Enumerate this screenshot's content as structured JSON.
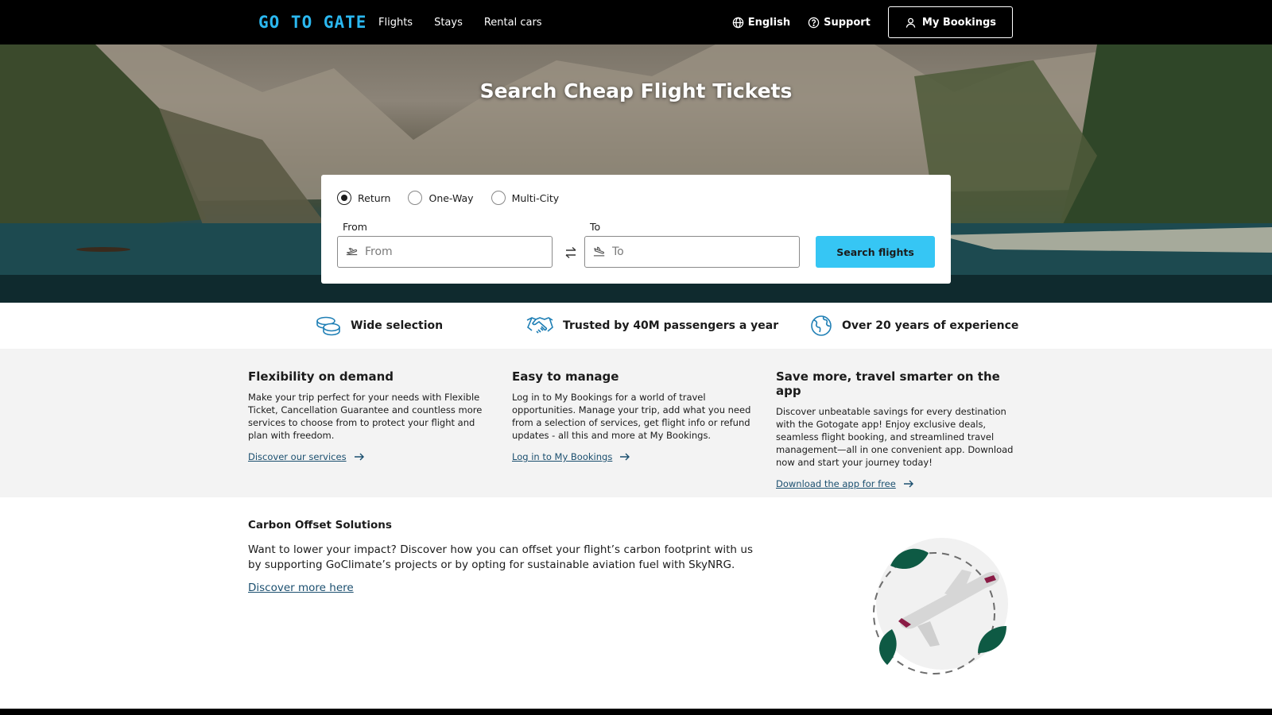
{
  "header": {
    "logo": "GO TO GATE",
    "nav": [
      "Flights",
      "Stays",
      "Rental cars"
    ],
    "language": "English",
    "support": "Support",
    "my_bookings": "My Bookings"
  },
  "hero": {
    "title": "Search Cheap Flight Tickets",
    "trip_types": [
      "Return",
      "One-Way",
      "Multi-City"
    ],
    "selected_trip_type": "Return",
    "from_label": "From",
    "from_placeholder": "From",
    "to_label": "To",
    "to_placeholder": "To",
    "search_button": "Search flights"
  },
  "usp": [
    "Wide selection",
    "Trusted by 40M passengers a year",
    "Over 20 years of experience"
  ],
  "features": [
    {
      "title": "Flexibility on demand",
      "text": "Make your trip perfect for your needs with Flexible Ticket, Cancellation Guarantee and countless more services to choose from to protect your flight and plan with freedom.",
      "link": "Discover our services"
    },
    {
      "title": "Easy to manage",
      "text": "Log in to My Bookings for a world of travel opportunities. Manage your trip, add what you need from a selection of services, get flight info or refund updates - all this and more at My Bookings.",
      "link": "Log in to My Bookings"
    },
    {
      "title": "Save more, travel smarter on the app",
      "text": "Discover unbeatable savings for every destination with the Gotogate app! Enjoy exclusive deals, seamless flight booking, and streamlined travel management—all in one convenient app. Download now and start your journey today!",
      "link": "Download the app for free"
    }
  ],
  "carbon": {
    "title": "Carbon Offset Solutions",
    "text": "Want to lower your impact? Discover how you can offset your flight’s carbon footprint with us by supporting GoClimate’s projects or by opting for sustainable aviation fuel with SkyNRG.",
    "link": "Discover more here"
  },
  "colors": {
    "accent": "#36c6f4",
    "logo": "#2bb8f0",
    "link": "#1b4f6f",
    "header_bg": "#000000",
    "feature_bg": "#f3f3f3",
    "leaf": "#0e5a44",
    "plane_accent": "#8a1b45"
  }
}
